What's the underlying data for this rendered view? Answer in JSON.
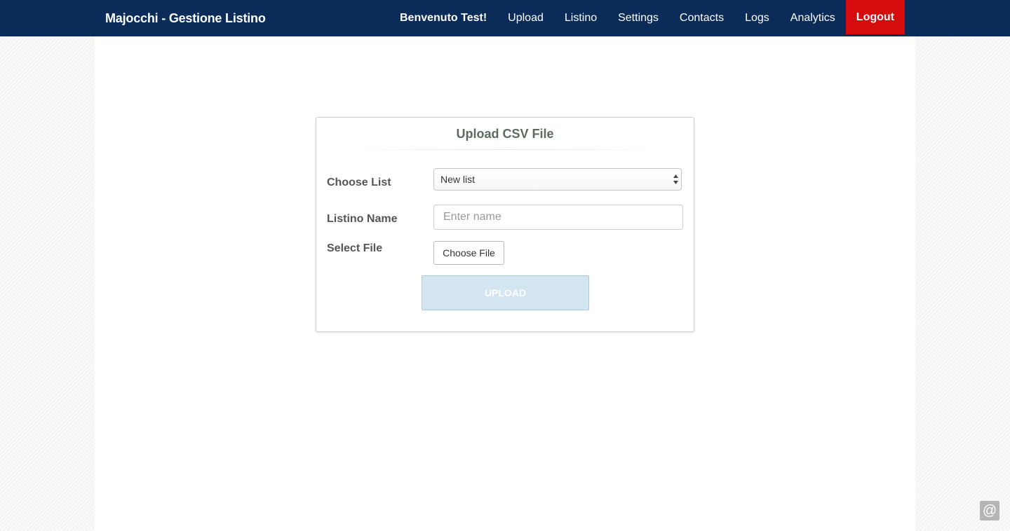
{
  "navbar": {
    "brand": "Majocchi - Gestione Listino",
    "welcome": "Benvenuto Test!",
    "items": [
      {
        "label": "Upload"
      },
      {
        "label": "Listino"
      },
      {
        "label": "Settings"
      },
      {
        "label": "Contacts"
      },
      {
        "label": "Logs"
      },
      {
        "label": "Analytics"
      }
    ],
    "logout_label": "Logout"
  },
  "upload_panel": {
    "title": "Upload CSV File",
    "choose_list_label": "Choose List",
    "choose_list_selected": "New list",
    "listino_name_label": "Listino Name",
    "listino_name_placeholder": "Enter name",
    "listino_name_value": "",
    "select_file_label": "Select File",
    "choose_file_button": "Choose File",
    "upload_button": "UPLOAD",
    "upload_button_enabled": false
  },
  "floating": {
    "at_icon": "@"
  },
  "colors": {
    "navbar_bg": "#0b2c59",
    "logout_bg": "#d60b0b",
    "upload_disabled_bg": "#d3e5f1"
  }
}
